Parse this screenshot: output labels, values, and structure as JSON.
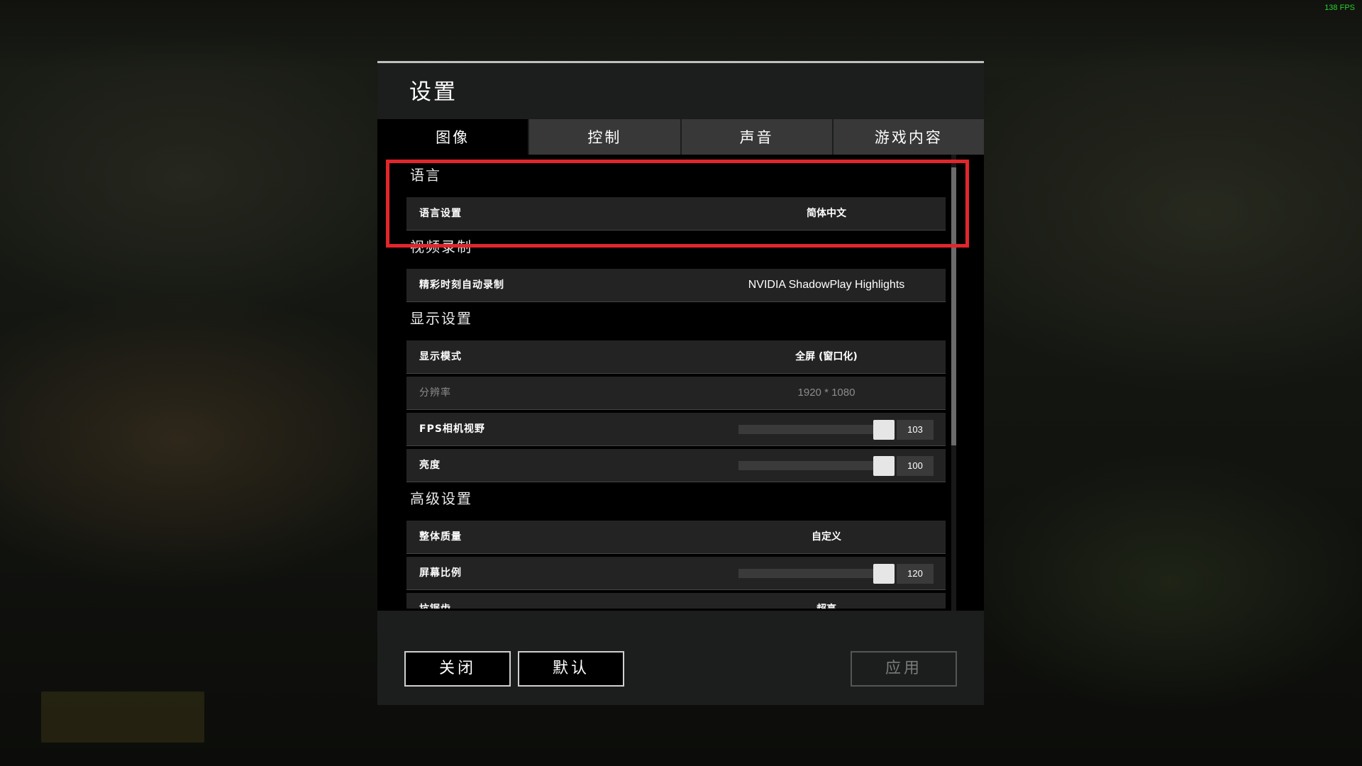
{
  "overlay": {
    "fps": "138 FPS"
  },
  "dialog": {
    "title": "设置",
    "tabs": [
      {
        "label": "图像",
        "active": true
      },
      {
        "label": "控制",
        "active": false
      },
      {
        "label": "声音",
        "active": false
      },
      {
        "label": "游戏内容",
        "active": false
      }
    ],
    "sections": {
      "language": {
        "header": "语言",
        "language_setting": {
          "label": "语言设置",
          "value": "简体中文"
        }
      },
      "video_recording": {
        "header": "视频录制",
        "highlights": {
          "label": "精彩时刻自动录制",
          "value": "NVIDIA ShadowPlay Highlights"
        }
      },
      "display": {
        "header": "显示设置",
        "display_mode": {
          "label": "显示模式",
          "value": "全屏 (窗口化)"
        },
        "resolution": {
          "label": "分辨率",
          "value": "1920 * 1080"
        },
        "fps_fov": {
          "label": "FPS相机视野",
          "value": "103"
        },
        "brightness": {
          "label": "亮度",
          "value": "100"
        }
      },
      "advanced": {
        "header": "高级设置",
        "overall_quality": {
          "label": "整体质量",
          "value": "自定义"
        },
        "screen_scale": {
          "label": "屏幕比例",
          "value": "120"
        },
        "anti_aliasing": {
          "label": "抗锯齿",
          "value": "超高"
        }
      }
    },
    "buttons": {
      "close": "关闭",
      "default": "默认",
      "apply": "应用"
    }
  },
  "colors": {
    "highlight_border": "#e2262c",
    "fps_text": "#29d12f",
    "active_tab": "#000000",
    "inactive_tab": "#383838"
  },
  "icons": []
}
